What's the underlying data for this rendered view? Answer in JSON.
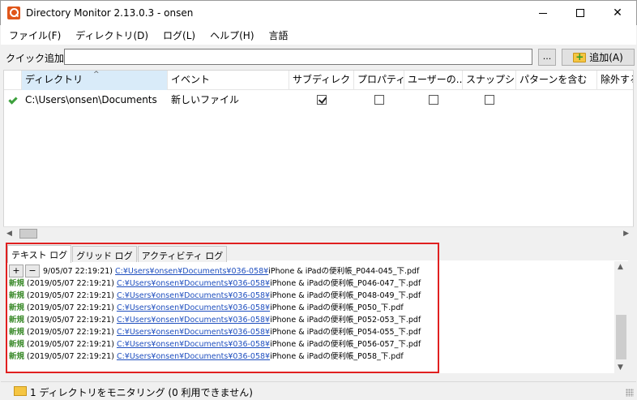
{
  "window": {
    "title": "Directory Monitor 2.13.0.3 - onsen",
    "min_glyph": "",
    "max_glyph": "",
    "close_glyph": "✕"
  },
  "menu": {
    "items": [
      "ファイル(F)",
      "ディレクトリ(D)",
      "ログ(L)",
      "ヘルプ(H)",
      "言語"
    ]
  },
  "quick_add": {
    "label": "クイック追加:",
    "value": "",
    "browse_label": "...",
    "add_label": "追加(A)"
  },
  "grid": {
    "columns": [
      "ディレクトリ",
      "イベント",
      "サブディレクトリ",
      "プロパティ",
      "ユーザーの...",
      "スナップシ...",
      "パターンを含む",
      "除外する"
    ],
    "rows": [
      {
        "directory": "C:\\Users\\onsen\\Documents",
        "event": "新しいファイル",
        "subdirectory": true,
        "property": false,
        "user": false,
        "snapshot": false
      }
    ]
  },
  "log": {
    "tabs": [
      "テキスト ログ",
      "グリッド ログ",
      "アクティビティ ログ"
    ],
    "plus_label": "+",
    "minus_label": "−",
    "lines": [
      {
        "kw": "",
        "time": "9/05/07 22:19:21)",
        "path": "C:¥Users¥onsen¥Documents¥036-058¥",
        "file": "iPhone & iPadの便利帳_P044-045_下.pdf"
      },
      {
        "kw": "新規",
        "time": "(2019/05/07 22:19:21)",
        "path": "C:¥Users¥onsen¥Documents¥036-058¥",
        "file": "iPhone & iPadの便利帳_P046-047_下.pdf"
      },
      {
        "kw": "新規",
        "time": "(2019/05/07 22:19:21)",
        "path": "C:¥Users¥onsen¥Documents¥036-058¥",
        "file": "iPhone & iPadの便利帳_P048-049_下.pdf"
      },
      {
        "kw": "新規",
        "time": "(2019/05/07 22:19:21)",
        "path": "C:¥Users¥onsen¥Documents¥036-058¥",
        "file": "iPhone & iPadの便利帳_P050_下.pdf"
      },
      {
        "kw": "新規",
        "time": "(2019/05/07 22:19:21)",
        "path": "C:¥Users¥onsen¥Documents¥036-058¥",
        "file": "iPhone & iPadの便利帳_P052-053_下.pdf"
      },
      {
        "kw": "新規",
        "time": "(2019/05/07 22:19:21)",
        "path": "C:¥Users¥onsen¥Documents¥036-058¥",
        "file": "iPhone & iPadの便利帳_P054-055_下.pdf"
      },
      {
        "kw": "新規",
        "time": "(2019/05/07 22:19:21)",
        "path": "C:¥Users¥onsen¥Documents¥036-058¥",
        "file": "iPhone & iPadの便利帳_P056-057_下.pdf"
      },
      {
        "kw": "新規",
        "time": "(2019/05/07 22:19:21)",
        "path": "C:¥Users¥onsen¥Documents¥036-058¥",
        "file": "iPhone & iPadの便利帳_P058_下.pdf"
      }
    ]
  },
  "status": {
    "text": "1 ディレクトリをモニタリング (0 利用できません)"
  },
  "colors": {
    "highlight_border": "#e02020",
    "log_keyword": "#3a8a2a",
    "log_path": "#1f4fbf",
    "sorted_column": "#d9ebf9",
    "check_icon": "#3ca03c"
  },
  "icons": {
    "app": "directory-monitor-icon",
    "add": "folder-add-icon",
    "status": "folder-icon",
    "row_status": "check-icon"
  }
}
